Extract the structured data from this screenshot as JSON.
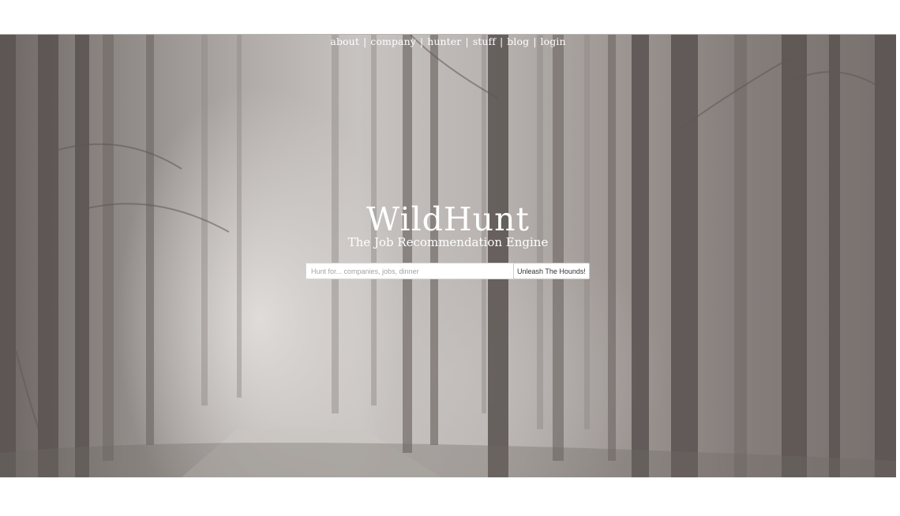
{
  "nav": {
    "items": [
      "about",
      "company",
      "hunter",
      "stuff",
      "blog",
      "login"
    ],
    "separator": "|"
  },
  "hero": {
    "title": "WildHunt",
    "subtitle": "The Job Recommendation Engine"
  },
  "search": {
    "placeholder": "Hunt for... companies, jobs, dinner",
    "value": "",
    "button_label": "Unleash The Hounds!"
  },
  "colors": {
    "text": "#ffffff",
    "background_tone": "#9f9895"
  }
}
